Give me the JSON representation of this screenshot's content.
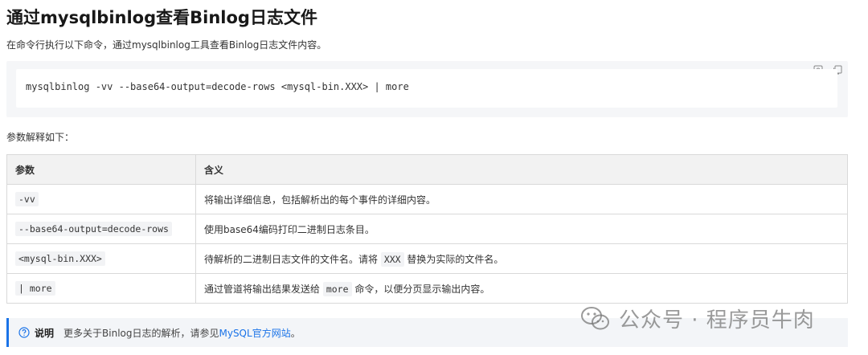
{
  "title": "通过mysqlbinlog查看Binlog日志文件",
  "intro": "在命令行执行以下命令，通过mysqlbinlog工具查看Binlog日志文件内容。",
  "code": {
    "line": "mysqlbinlog -vv --base64-output=decode-rows <mysql-bin.XXX> | more",
    "icons": [
      "run-icon",
      "copy-icon"
    ]
  },
  "params_label": "参数解释如下：",
  "table": {
    "headers": [
      "参数",
      "含义"
    ],
    "rows": [
      {
        "param": "-vv",
        "desc": "将输出详细信息，包括解析出的每个事件的详细内容。"
      },
      {
        "param": "--base64-output=decode-rows",
        "desc": "使用base64编码打印二进制日志条目。"
      },
      {
        "param": "<mysql-bin.XXX>",
        "desc_pre": "待解析的二进制日志文件的文件名。请将 ",
        "desc_code": "XXX",
        "desc_post": " 替换为实际的文件名。"
      },
      {
        "param": "| more",
        "desc_pre": "通过管道将输出结果发送给 ",
        "desc_code": "more",
        "desc_post": " 命令，以便分页显示输出内容。"
      }
    ]
  },
  "note": {
    "icon": "help-circle-icon",
    "label": "说明",
    "text": "更多关于Binlog日志的解析，请参见",
    "link": "MySQL官方网站",
    "suffix": "。"
  },
  "watermark": {
    "icon": "wechat-icon",
    "text": "公众号 · 程序员牛肉"
  },
  "colors": {
    "accent": "#1a73e8",
    "code_bg": "#f5f6f8",
    "table_header_bg": "#f2f2f2"
  }
}
